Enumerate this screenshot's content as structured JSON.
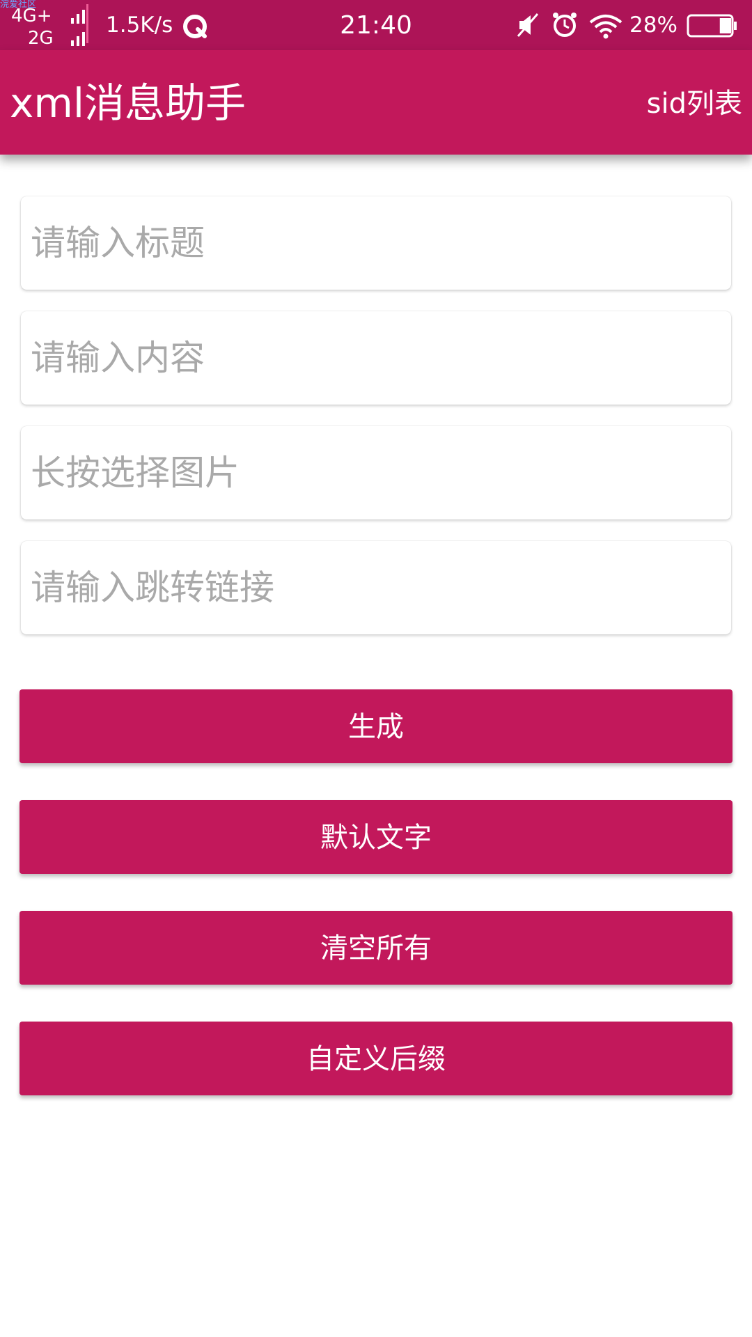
{
  "status_bar": {
    "watermark": "浣爱社区",
    "network_primary": "4G+",
    "network_secondary": "2G",
    "speed": "1.5K/s",
    "time": "21:40",
    "battery_percent": "28%",
    "battery_level": 0.28,
    "background_color": "#ad1457"
  },
  "app_bar": {
    "title": "xml消息助手",
    "action_label": "sid列表",
    "background_color": "#c2185b"
  },
  "form": {
    "title_placeholder": "请输入标题",
    "content_placeholder": "请输入内容",
    "image_placeholder": "长按选择图片",
    "link_placeholder": "请输入跳转链接"
  },
  "buttons": {
    "generate": "生成",
    "default_text": "默认文字",
    "clear_all": "清空所有",
    "custom_suffix": "自定义后缀"
  },
  "icons": [
    "signal-bars-icon",
    "q-app-icon",
    "mute-icon",
    "alarm-icon",
    "wifi-icon",
    "battery-icon"
  ]
}
